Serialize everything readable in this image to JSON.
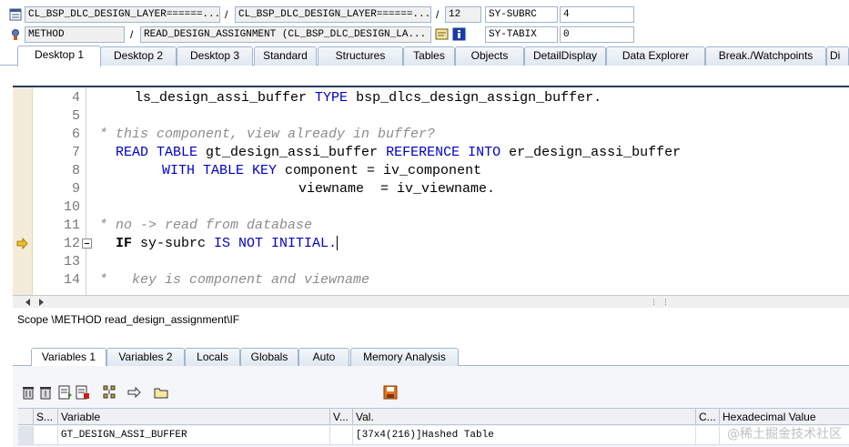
{
  "top": {
    "row1": {
      "program": "CL_BSP_DLC_DESIGN_LAYER======...",
      "include": "CL_BSP_DLC_DESIGN_LAYER======...",
      "line": "12",
      "sysvar_name": "SY-SUBRC",
      "sysvar_value": "4"
    },
    "row2": {
      "event_type": "METHOD",
      "event_name": "READ_DESIGN_ASSIGNMENT (CL_BSP_DLC_DESIGN_LA...",
      "sysvar_name": "SY-TABIX",
      "sysvar_value": "0"
    },
    "separator": "/"
  },
  "desktop_tabs": [
    "Desktop 1",
    "Desktop 2",
    "Desktop 3",
    "Standard",
    "Structures",
    "Tables",
    "Objects",
    "DetailDisplay",
    "Data Explorer",
    "Break./Watchpoints",
    "Di"
  ],
  "code_lines": [
    {
      "num": "4"
    },
    {
      "num": "5"
    },
    {
      "num": "6"
    },
    {
      "num": "7"
    },
    {
      "num": "8"
    },
    {
      "num": "9"
    },
    {
      "num": "10"
    },
    {
      "num": "11"
    },
    {
      "num": "12"
    },
    {
      "num": "13"
    },
    {
      "num": "14"
    }
  ],
  "code": {
    "l4_a": "ls_design_assi_buffer ",
    "l4_kw": "TYPE",
    "l4_b": " bsp_dlcs_design_assign_buffer.",
    "l6": "* this component, view already in buffer?",
    "l7_kw1": "READ TABLE",
    "l7_a": " gt_design_assi_buffer ",
    "l7_kw2": "REFERENCE INTO",
    "l7_b": " er_design_assi_buffer",
    "l8_kw": "WITH TABLE KEY",
    "l8_a": " component = iv_component",
    "l9": "viewname  = iv_viewname.",
    "l11": "* no -> read from database",
    "l12_kw1": "IF",
    "l12_a": " sy-subrc ",
    "l12_kw2": "IS NOT INITIAL.",
    "l14": "*   key is component and viewname"
  },
  "scope": "Scope \\METHOD read_design_assignment\\IF",
  "variable_tabs": [
    "Variables 1",
    "Variables 2",
    "Locals",
    "Globals",
    "Auto",
    "Memory Analysis"
  ],
  "table": {
    "headers": [
      "S...",
      "Variable",
      "V...",
      "Val.",
      "C...",
      "Hexadecimal Value"
    ],
    "rows": [
      {
        "variable": "GT_DESIGN_ASSI_BUFFER",
        "value": "[37x4(216)]Hashed Table"
      }
    ]
  },
  "watermark": "@稀土掘金技术社区"
}
